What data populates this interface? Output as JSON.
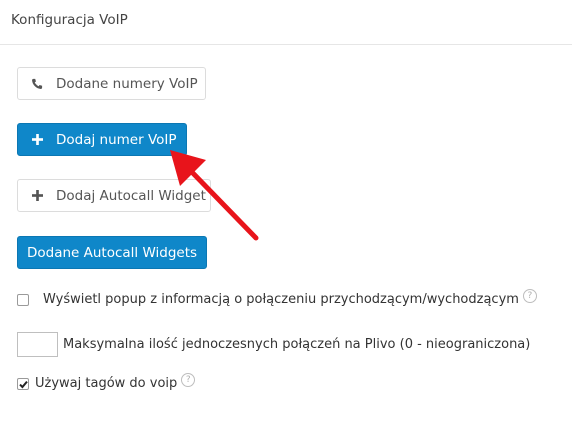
{
  "header": {
    "title": "Konfiguracja VoIP"
  },
  "buttons": {
    "numbers": {
      "label": "Dodane numery VoIP",
      "icon": "phone-icon"
    },
    "add_number": {
      "label": "Dodaj numer VoIP",
      "icon": "plus-icon"
    },
    "add_widget": {
      "label": "Dodaj Autocall Widget",
      "icon": "plus-icon"
    },
    "widgets": {
      "label": "Dodane Autocall Widgets"
    }
  },
  "options": {
    "popup": {
      "label": "Wyświetl popup z informacją o połączeniu przychodzącym/wychodzącym",
      "checked": false,
      "help": "?"
    },
    "max_calls": {
      "label": "Maksymalna ilość jednoczesnych połączeń na Plivo (0 - nieograniczona)",
      "value": ""
    },
    "tags": {
      "label": "Używaj tagów do voip",
      "checked": true,
      "help": "?"
    }
  },
  "colors": {
    "primary": "#0f87c9",
    "arrow": "#e8141b"
  }
}
